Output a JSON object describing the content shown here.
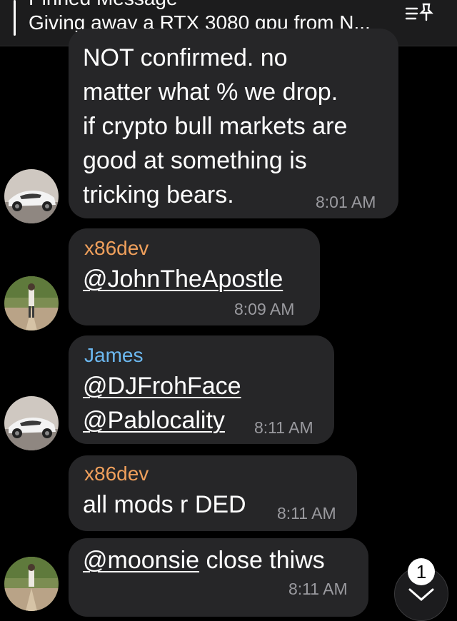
{
  "pinned": {
    "title": "Pinned Message",
    "text": "Giving away a RTX 3080 gpu from N..."
  },
  "messages": [
    {
      "lines": [
        "NOT confirmed. no",
        "matter what % we drop.",
        "if crypto bull markets are",
        "good at something is",
        "tricking bears."
      ],
      "time": "8:01 AM"
    },
    {
      "sender": "x86dev",
      "mention": "@JohnTheApostle",
      "time": "8:09 AM"
    },
    {
      "sender": "James",
      "mention1": "@DJFrohFace",
      "mention2": "@Pablocality",
      "time": "8:11 AM"
    },
    {
      "sender": "x86dev",
      "text": "all mods r DED",
      "time": "8:11 AM"
    },
    {
      "mention": "@moonsie",
      "text": " close thiws",
      "time": "8:11 AM"
    }
  ],
  "unread_count": "1",
  "colors": {
    "bubble": "#262628",
    "sender_orange": "#f0a05c",
    "sender_blue": "#6cb8f0",
    "time": "#9a9a9f"
  },
  "icons": {
    "pinned_list": "pin-list-icon",
    "scroll_down": "chevron-down-icon"
  }
}
